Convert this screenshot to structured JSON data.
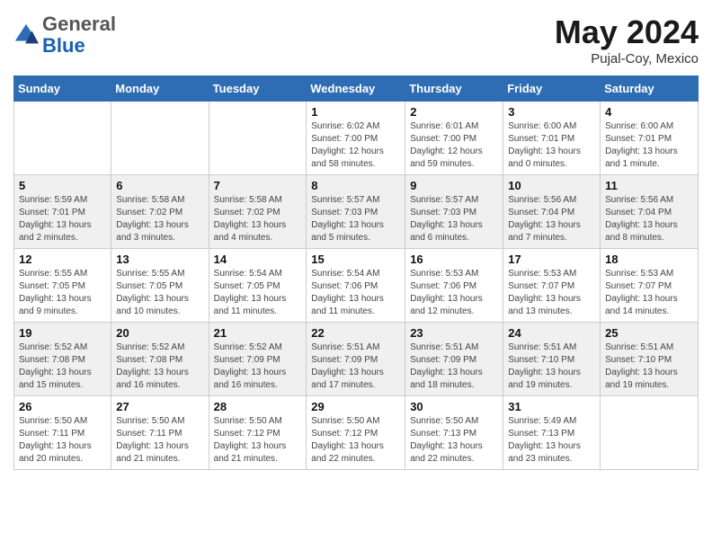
{
  "header": {
    "logo_general": "General",
    "logo_blue": "Blue",
    "title": "May 2024",
    "location": "Pujal-Coy, Mexico"
  },
  "weekdays": [
    "Sunday",
    "Monday",
    "Tuesday",
    "Wednesday",
    "Thursday",
    "Friday",
    "Saturday"
  ],
  "weeks": [
    [
      {
        "num": "",
        "info": ""
      },
      {
        "num": "",
        "info": ""
      },
      {
        "num": "",
        "info": ""
      },
      {
        "num": "1",
        "info": "Sunrise: 6:02 AM\nSunset: 7:00 PM\nDaylight: 12 hours and 58 minutes."
      },
      {
        "num": "2",
        "info": "Sunrise: 6:01 AM\nSunset: 7:00 PM\nDaylight: 12 hours and 59 minutes."
      },
      {
        "num": "3",
        "info": "Sunrise: 6:00 AM\nSunset: 7:01 PM\nDaylight: 13 hours and 0 minutes."
      },
      {
        "num": "4",
        "info": "Sunrise: 6:00 AM\nSunset: 7:01 PM\nDaylight: 13 hours and 1 minute."
      }
    ],
    [
      {
        "num": "5",
        "info": "Sunrise: 5:59 AM\nSunset: 7:01 PM\nDaylight: 13 hours and 2 minutes."
      },
      {
        "num": "6",
        "info": "Sunrise: 5:58 AM\nSunset: 7:02 PM\nDaylight: 13 hours and 3 minutes."
      },
      {
        "num": "7",
        "info": "Sunrise: 5:58 AM\nSunset: 7:02 PM\nDaylight: 13 hours and 4 minutes."
      },
      {
        "num": "8",
        "info": "Sunrise: 5:57 AM\nSunset: 7:03 PM\nDaylight: 13 hours and 5 minutes."
      },
      {
        "num": "9",
        "info": "Sunrise: 5:57 AM\nSunset: 7:03 PM\nDaylight: 13 hours and 6 minutes."
      },
      {
        "num": "10",
        "info": "Sunrise: 5:56 AM\nSunset: 7:04 PM\nDaylight: 13 hours and 7 minutes."
      },
      {
        "num": "11",
        "info": "Sunrise: 5:56 AM\nSunset: 7:04 PM\nDaylight: 13 hours and 8 minutes."
      }
    ],
    [
      {
        "num": "12",
        "info": "Sunrise: 5:55 AM\nSunset: 7:05 PM\nDaylight: 13 hours and 9 minutes."
      },
      {
        "num": "13",
        "info": "Sunrise: 5:55 AM\nSunset: 7:05 PM\nDaylight: 13 hours and 10 minutes."
      },
      {
        "num": "14",
        "info": "Sunrise: 5:54 AM\nSunset: 7:05 PM\nDaylight: 13 hours and 11 minutes."
      },
      {
        "num": "15",
        "info": "Sunrise: 5:54 AM\nSunset: 7:06 PM\nDaylight: 13 hours and 11 minutes."
      },
      {
        "num": "16",
        "info": "Sunrise: 5:53 AM\nSunset: 7:06 PM\nDaylight: 13 hours and 12 minutes."
      },
      {
        "num": "17",
        "info": "Sunrise: 5:53 AM\nSunset: 7:07 PM\nDaylight: 13 hours and 13 minutes."
      },
      {
        "num": "18",
        "info": "Sunrise: 5:53 AM\nSunset: 7:07 PM\nDaylight: 13 hours and 14 minutes."
      }
    ],
    [
      {
        "num": "19",
        "info": "Sunrise: 5:52 AM\nSunset: 7:08 PM\nDaylight: 13 hours and 15 minutes."
      },
      {
        "num": "20",
        "info": "Sunrise: 5:52 AM\nSunset: 7:08 PM\nDaylight: 13 hours and 16 minutes."
      },
      {
        "num": "21",
        "info": "Sunrise: 5:52 AM\nSunset: 7:09 PM\nDaylight: 13 hours and 16 minutes."
      },
      {
        "num": "22",
        "info": "Sunrise: 5:51 AM\nSunset: 7:09 PM\nDaylight: 13 hours and 17 minutes."
      },
      {
        "num": "23",
        "info": "Sunrise: 5:51 AM\nSunset: 7:09 PM\nDaylight: 13 hours and 18 minutes."
      },
      {
        "num": "24",
        "info": "Sunrise: 5:51 AM\nSunset: 7:10 PM\nDaylight: 13 hours and 19 minutes."
      },
      {
        "num": "25",
        "info": "Sunrise: 5:51 AM\nSunset: 7:10 PM\nDaylight: 13 hours and 19 minutes."
      }
    ],
    [
      {
        "num": "26",
        "info": "Sunrise: 5:50 AM\nSunset: 7:11 PM\nDaylight: 13 hours and 20 minutes."
      },
      {
        "num": "27",
        "info": "Sunrise: 5:50 AM\nSunset: 7:11 PM\nDaylight: 13 hours and 21 minutes."
      },
      {
        "num": "28",
        "info": "Sunrise: 5:50 AM\nSunset: 7:12 PM\nDaylight: 13 hours and 21 minutes."
      },
      {
        "num": "29",
        "info": "Sunrise: 5:50 AM\nSunset: 7:12 PM\nDaylight: 13 hours and 22 minutes."
      },
      {
        "num": "30",
        "info": "Sunrise: 5:50 AM\nSunset: 7:13 PM\nDaylight: 13 hours and 22 minutes."
      },
      {
        "num": "31",
        "info": "Sunrise: 5:49 AM\nSunset: 7:13 PM\nDaylight: 13 hours and 23 minutes."
      },
      {
        "num": "",
        "info": ""
      }
    ]
  ]
}
